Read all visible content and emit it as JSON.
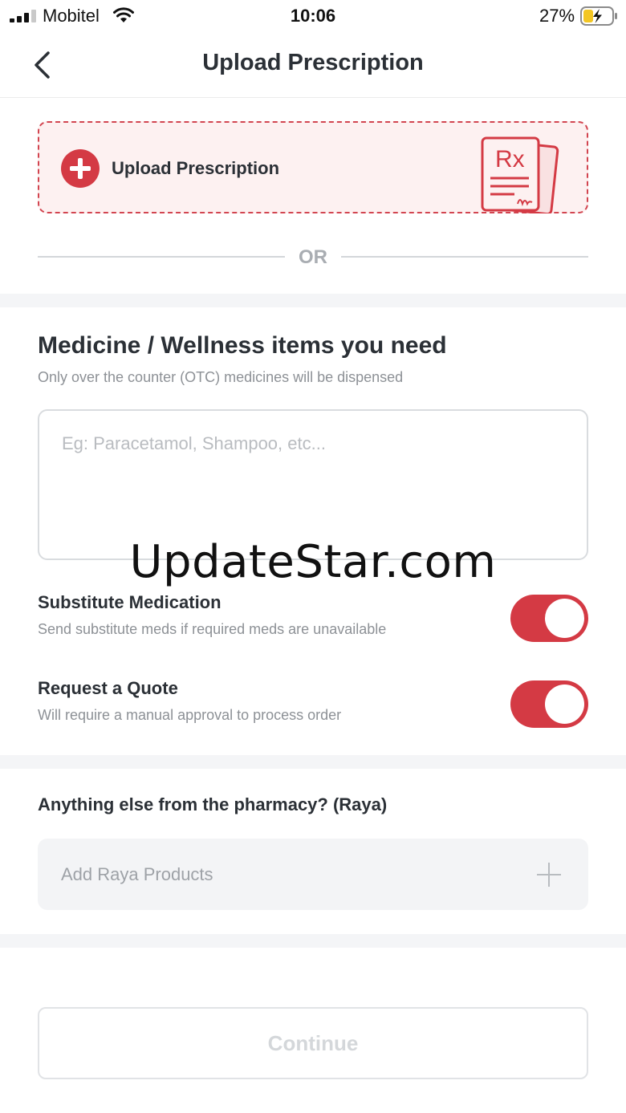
{
  "status_bar": {
    "carrier": "Mobitel",
    "time": "10:06",
    "battery_percent": "27%",
    "battery_level": 0.27
  },
  "header": {
    "title": "Upload Prescription",
    "back_icon": "chevron-left-icon"
  },
  "upload": {
    "label": "Upload Prescription",
    "icon": "plus-circle-icon",
    "illustration": "rx-document-icon",
    "illustration_text": "Rx"
  },
  "divider": {
    "text": "OR"
  },
  "medicine": {
    "title": "Medicine / Wellness items you need",
    "subtitle": "Only over the counter (OTC) medicines will be dispensed",
    "input_value": "",
    "input_placeholder": "Eg: Paracetamol, Shampoo, etc..."
  },
  "watermark": "UpdateStar.com",
  "options": [
    {
      "title": "Substitute Medication",
      "description": "Send substitute meds if required meds are unavailable",
      "enabled": true
    },
    {
      "title": "Request a Quote",
      "description": "Will require a manual approval to process order",
      "enabled": true
    }
  ],
  "pharmacy": {
    "title": "Anything else from the pharmacy? (Raya)",
    "add_label": "Add Raya Products",
    "add_icon": "plus-icon"
  },
  "footer": {
    "continue_label": "Continue"
  },
  "colors": {
    "accent": "#d43a44",
    "upload_bg": "#fdf1f1",
    "text_primary": "#2b3036",
    "text_secondary": "#8d9196",
    "section_gap": "#f4f5f7"
  }
}
